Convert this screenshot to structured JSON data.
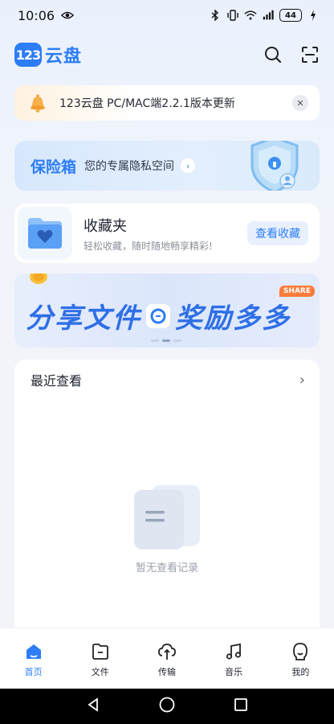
{
  "status_bar": {
    "time": "10:06",
    "battery": "44"
  },
  "header": {
    "logo_mark": "123",
    "logo_text": "云盘"
  },
  "notice": {
    "text": "123云盘 PC/MAC端2.2.1版本更新"
  },
  "vault": {
    "title": "保险箱",
    "subtitle": "您的专属隐私空间",
    "arrow": "›"
  },
  "favorites": {
    "title": "收藏夹",
    "subtitle": "轻松收藏，随时随地畅享精彩!",
    "button": "查看收藏"
  },
  "share_banner": {
    "left_text": "分享文件",
    "right_text": "奖励多多",
    "tag": "SHARE"
  },
  "recent": {
    "title": "最近查看",
    "chevron": "›",
    "empty_text": "暂无查看记录"
  },
  "bottom_nav": {
    "items": [
      {
        "label": "首页",
        "icon": "home-icon",
        "active": true
      },
      {
        "label": "文件",
        "icon": "folder-icon",
        "active": false
      },
      {
        "label": "传输",
        "icon": "transfer-icon",
        "active": false
      },
      {
        "label": "音乐",
        "icon": "music-icon",
        "active": false
      },
      {
        "label": "我的",
        "icon": "profile-icon",
        "active": false
      }
    ]
  },
  "colors": {
    "accent": "#2d7df6",
    "background": "#eef2fa"
  }
}
